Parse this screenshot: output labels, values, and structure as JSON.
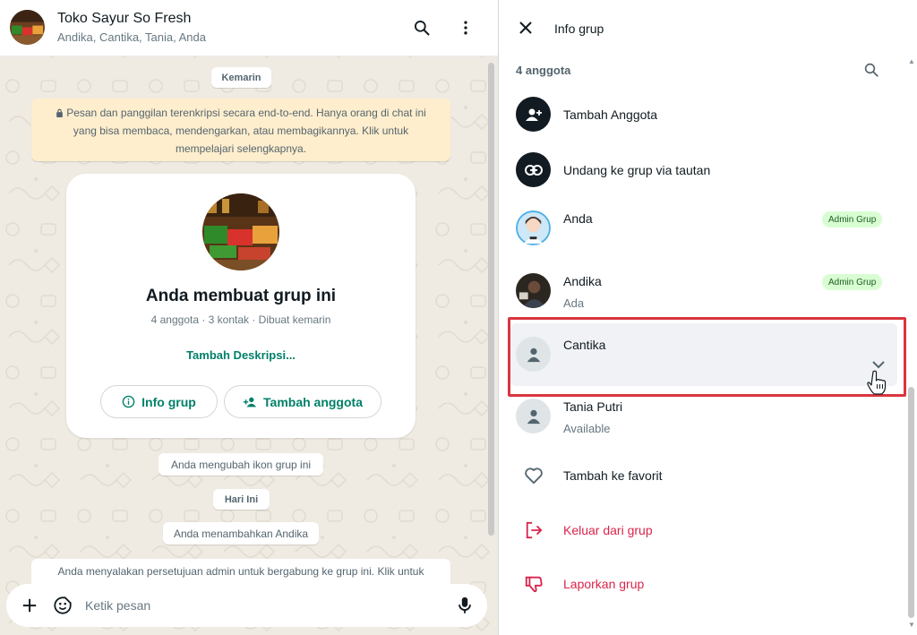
{
  "chat": {
    "title": "Toko Sayur So Fresh",
    "participants": "Andika, Cantika, Tania, Anda",
    "header_icons": [
      "search-icon",
      "menu-icon"
    ],
    "date_yesterday": "Kemarin",
    "encryption_notice": "Pesan dan panggilan terenkripsi secara end-to-end. Hanya orang di chat ini yang bisa membaca, mendengarkan, atau membagikannya. Klik untuk mempelajari selengkapnya.",
    "group_card": {
      "title": "Anda membuat grup ini",
      "subtitle": "4 anggota · 3 kontak · Dibuat kemarin",
      "add_description": "Tambah Deskripsi...",
      "info_button": "Info grup",
      "add_member_button": "Tambah anggota"
    },
    "system_messages": {
      "icon_changed": "Anda mengubah ikon grup ini",
      "date_today": "Hari Ini",
      "member_added": "Anda menambahkan Andika",
      "admin_approval": "Anda menyalakan persetujuan admin untuk bergabung ke grup ini. Klik untuk"
    },
    "composer": {
      "placeholder": "Ketik pesan",
      "icons": [
        "plus-icon",
        "sticker-icon",
        "mic-icon"
      ]
    }
  },
  "info": {
    "title": "Info grup",
    "members_count": "4 anggota",
    "actions": {
      "add_member": "Tambah Anggota",
      "invite_link": "Undang ke grup via tautan"
    },
    "members": [
      {
        "name": "Anda",
        "status": "",
        "badge": "Admin Grup"
      },
      {
        "name": "Andika",
        "status": "Ada",
        "badge": "Admin Grup"
      },
      {
        "name": "Cantika",
        "status": "",
        "badge": ""
      },
      {
        "name": "Tania Putri",
        "status": "Available",
        "badge": ""
      }
    ],
    "favorite": "Tambah ke favorit",
    "exit_group": "Keluar dari grup",
    "report_group": "Laporkan grup"
  },
  "colors": {
    "accent": "#008069",
    "danger": "#d9254c",
    "highlight": "#d9363e",
    "chat_bg": "#efeae2",
    "notice_bg": "#ffeecd",
    "badge_bg": "#d9fdd3"
  }
}
